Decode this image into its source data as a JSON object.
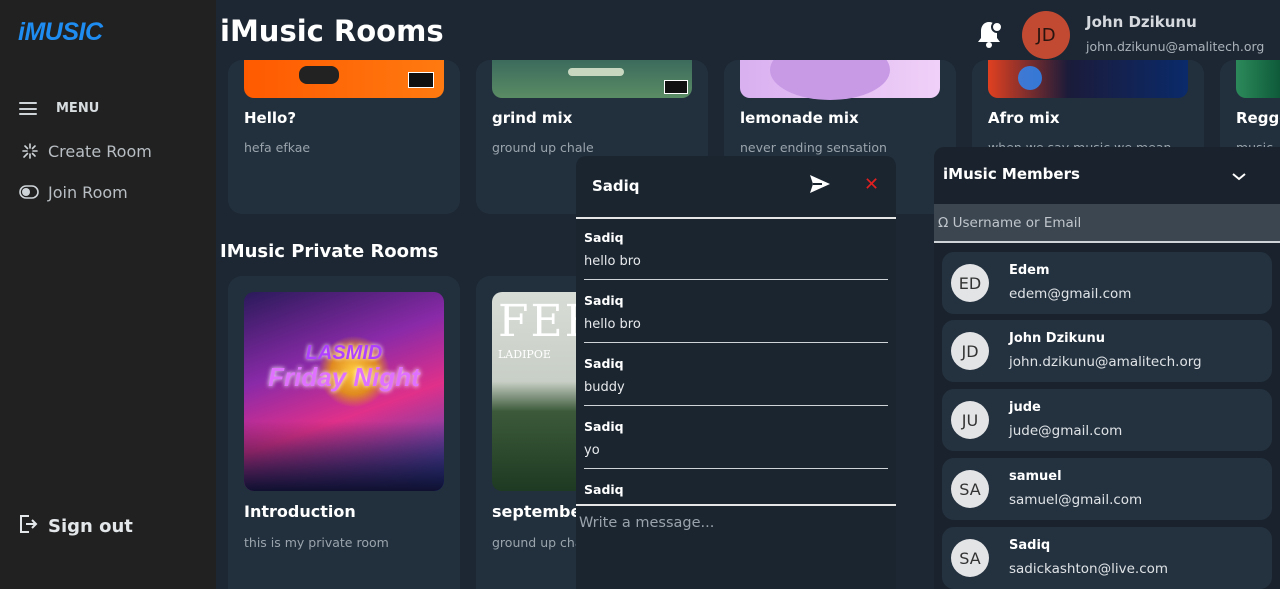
{
  "brand": {
    "logo_text": "iMUSIC",
    "accent": "#1e8cf0"
  },
  "sidebar": {
    "menu_label": "MENU",
    "items": [
      {
        "label": "Create Room",
        "icon": "sparkle-icon"
      },
      {
        "label": "Join Room",
        "icon": "toggle-icon"
      }
    ],
    "sign_out_label": "Sign out"
  },
  "header": {
    "title": "iMusic Rooms",
    "user": {
      "initials": "JD",
      "name": "John Dzikunu",
      "email": "john.dzikunu@amalitech.org"
    }
  },
  "public_rooms": [
    {
      "name": "Hello?",
      "desc": "hefa efkae"
    },
    {
      "name": "grind mix",
      "desc": "ground up chale"
    },
    {
      "name": "lemonade mix",
      "desc": "never ending sensation"
    },
    {
      "name": "Afro mix",
      "desc": "when we say music we mean"
    },
    {
      "name": "Regge",
      "desc": "music"
    }
  ],
  "private_section_title": "IMusic Private Rooms",
  "private_rooms": [
    {
      "name": "Introduction",
      "desc": "this is my private room",
      "cover_text_1": "LASMID",
      "cover_text_2": "Friday Night"
    },
    {
      "name": "september",
      "desc": "ground up chale",
      "cover_text_1": "FEE",
      "cover_text_2": "LADIPOE"
    }
  ],
  "chat": {
    "title": "Sadiq",
    "messages": [
      {
        "author": "Sadiq",
        "text": "hello bro"
      },
      {
        "author": "Sadiq",
        "text": "hello bro"
      },
      {
        "author": "Sadiq",
        "text": "buddy"
      },
      {
        "author": "Sadiq",
        "text": "yo"
      },
      {
        "author": "Sadiq",
        "text": ""
      }
    ],
    "input_placeholder": "Write a message..."
  },
  "members_panel": {
    "title": "iMusic Members",
    "search_placeholder": "Ω Username or Email",
    "members": [
      {
        "initials": "ED",
        "name": "Edem",
        "email": "edem@gmail.com"
      },
      {
        "initials": "JD",
        "name": "John Dzikunu",
        "email": "john.dzikunu@amalitech.org"
      },
      {
        "initials": "JU",
        "name": "jude",
        "email": "jude@gmail.com"
      },
      {
        "initials": "SA",
        "name": "samuel",
        "email": "samuel@gmail.com"
      },
      {
        "initials": "SA",
        "name": "Sadiq",
        "email": "sadickashton@live.com"
      }
    ]
  }
}
